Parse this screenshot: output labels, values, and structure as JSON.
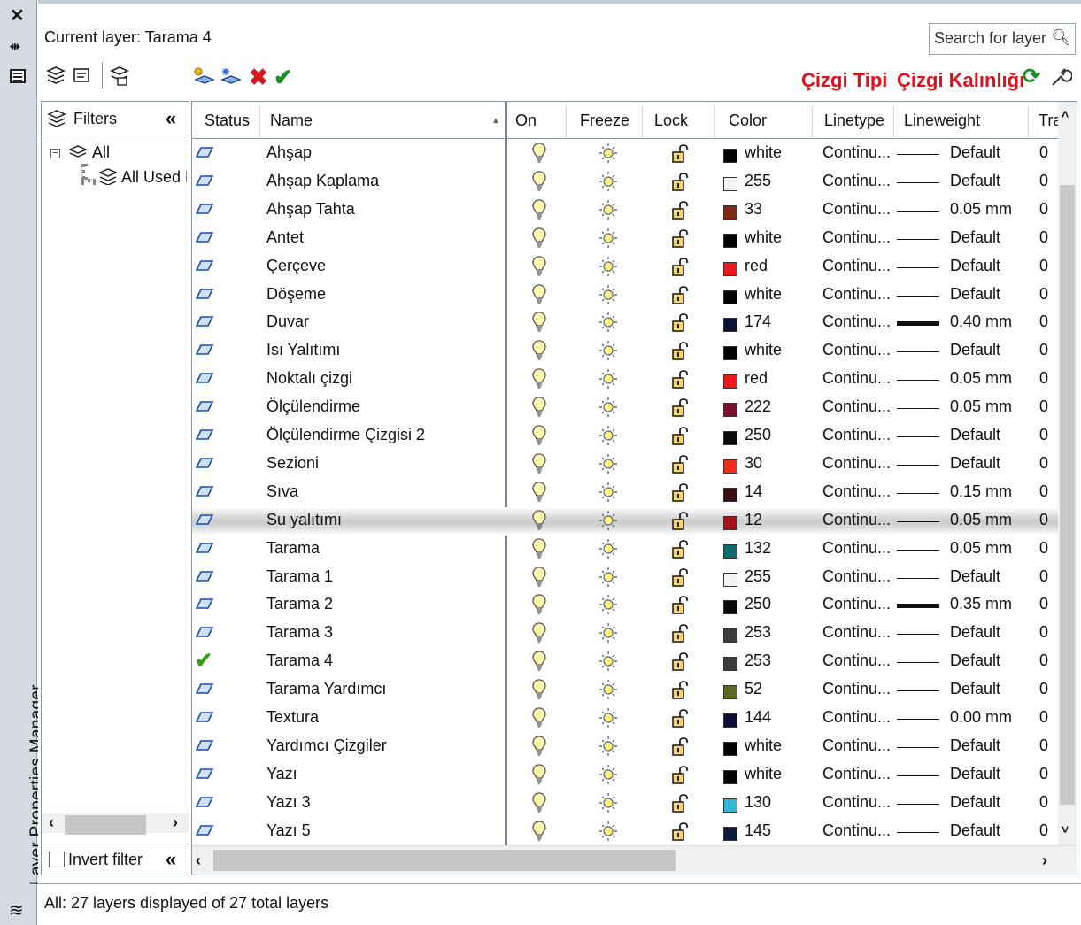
{
  "window": {
    "side_title": "Layer Properties Manager",
    "current_layer_label": "Current layer: Tarama 4"
  },
  "search": {
    "placeholder": "Search for layer"
  },
  "toolbar": {
    "linetype_label": "Çizgi Tipi",
    "lineweight_label": "Çizgi Kalınlığı"
  },
  "filters": {
    "header": "Filters",
    "tree": [
      {
        "label": "All"
      },
      {
        "label": "All Used L"
      }
    ],
    "invert_label": "Invert filter"
  },
  "columns": {
    "status": "Status",
    "name": "Name",
    "on": "On",
    "freeze": "Freeze",
    "lock": "Lock",
    "color": "Color",
    "linetype": "Linetype",
    "lineweight": "Lineweight",
    "transparency": "Tra"
  },
  "layers": [
    {
      "name": "Ahşap",
      "current": false,
      "color": "white",
      "hex": "#000000",
      "linetype": "Continu...",
      "lineweight": "Default",
      "thick": false,
      "trans": "0"
    },
    {
      "name": "Ahşap Kaplama",
      "current": false,
      "color": "255",
      "hex": "#f4f4f4",
      "linetype": "Continu...",
      "lineweight": "Default",
      "thick": false,
      "trans": "0"
    },
    {
      "name": "Ahşap Tahta",
      "current": false,
      "color": "33",
      "hex": "#7f2a12",
      "linetype": "Continu...",
      "lineweight": "0.05 mm",
      "thick": false,
      "trans": "0"
    },
    {
      "name": "Antet",
      "current": false,
      "color": "white",
      "hex": "#000000",
      "linetype": "Continu...",
      "lineweight": "Default",
      "thick": false,
      "trans": "0"
    },
    {
      "name": "Çerçeve",
      "current": false,
      "color": "red",
      "hex": "#e81a1a",
      "linetype": "Continu...",
      "lineweight": "Default",
      "thick": false,
      "trans": "0"
    },
    {
      "name": "Döşeme",
      "current": false,
      "color": "white",
      "hex": "#000000",
      "linetype": "Continu...",
      "lineweight": "Default",
      "thick": false,
      "trans": "0"
    },
    {
      "name": "Duvar",
      "current": false,
      "color": "174",
      "hex": "#0b1233",
      "linetype": "Continu...",
      "lineweight": "0.40 mm",
      "thick": true,
      "trans": "0"
    },
    {
      "name": "Isı Yalıtımı",
      "current": false,
      "color": "white",
      "hex": "#000000",
      "linetype": "Continu...",
      "lineweight": "Default",
      "thick": false,
      "trans": "0"
    },
    {
      "name": "Noktalı çizgi",
      "current": false,
      "color": "red",
      "hex": "#e81a1a",
      "linetype": "Continu...",
      "lineweight": "0.05 mm",
      "thick": false,
      "trans": "0"
    },
    {
      "name": "Ölçülendirme",
      "current": false,
      "color": "222",
      "hex": "#7a0e2c",
      "linetype": "Continu...",
      "lineweight": "0.05 mm",
      "thick": false,
      "trans": "0"
    },
    {
      "name": "Ölçülendirme Çizgisi 2",
      "current": false,
      "color": "250",
      "hex": "#0a0a0a",
      "linetype": "Continu...",
      "lineweight": "Default",
      "thick": false,
      "trans": "0"
    },
    {
      "name": "Sezioni",
      "current": false,
      "color": "30",
      "hex": "#e8301a",
      "linetype": "Continu...",
      "lineweight": "Default",
      "thick": false,
      "trans": "0"
    },
    {
      "name": "Sıva",
      "current": false,
      "color": "14",
      "hex": "#3a0e0e",
      "linetype": "Continu...",
      "lineweight": "0.15 mm",
      "thick": false,
      "trans": "0"
    },
    {
      "name": "Su yalıtımı",
      "current": false,
      "selected": true,
      "color": "12",
      "hex": "#a3141e",
      "linetype": "Continu...",
      "lineweight": "0.05 mm",
      "thick": false,
      "trans": "0"
    },
    {
      "name": "Tarama",
      "current": false,
      "color": "132",
      "hex": "#0d6b6b",
      "linetype": "Continu...",
      "lineweight": "0.05 mm",
      "thick": false,
      "trans": "0"
    },
    {
      "name": "Tarama 1",
      "current": false,
      "color": "255",
      "hex": "#f4f4f4",
      "linetype": "Continu...",
      "lineweight": "Default",
      "thick": false,
      "trans": "0"
    },
    {
      "name": "Tarama 2",
      "current": false,
      "color": "250",
      "hex": "#0a0a0a",
      "linetype": "Continu...",
      "lineweight": "0.35 mm",
      "thick": true,
      "trans": "0"
    },
    {
      "name": "Tarama 3",
      "current": false,
      "color": "253",
      "hex": "#3c3c3c",
      "linetype": "Continu...",
      "lineweight": "Default",
      "thick": false,
      "trans": "0"
    },
    {
      "name": "Tarama 4",
      "current": true,
      "color": "253",
      "hex": "#3c3c3c",
      "linetype": "Continu...",
      "lineweight": "Default",
      "thick": false,
      "trans": "0"
    },
    {
      "name": "Tarama Yardımcı",
      "current": false,
      "color": "52",
      "hex": "#5b6a1e",
      "linetype": "Continu...",
      "lineweight": "Default",
      "thick": false,
      "trans": "0"
    },
    {
      "name": "Textura",
      "current": false,
      "color": "144",
      "hex": "#0d0d3a",
      "linetype": "Continu...",
      "lineweight": "0.00 mm",
      "thick": false,
      "trans": "0"
    },
    {
      "name": "Yardımcı Çizgiler",
      "current": false,
      "color": "white",
      "hex": "#000000",
      "linetype": "Continu...",
      "lineweight": "Default",
      "thick": false,
      "trans": "0"
    },
    {
      "name": "Yazı",
      "current": false,
      "color": "white",
      "hex": "#000000",
      "linetype": "Continu...",
      "lineweight": "Default",
      "thick": false,
      "trans": "0"
    },
    {
      "name": "Yazı 3",
      "current": false,
      "color": "130",
      "hex": "#35b6d8",
      "linetype": "Continu...",
      "lineweight": "Default",
      "thick": false,
      "trans": "0"
    },
    {
      "name": "Yazı 5",
      "current": false,
      "color": "145",
      "hex": "#0b1a3a",
      "linetype": "Continu...",
      "lineweight": "Default",
      "thick": false,
      "trans": "0"
    }
  ],
  "status_bar": {
    "text": "All: 27 layers displayed of 27 total layers"
  }
}
